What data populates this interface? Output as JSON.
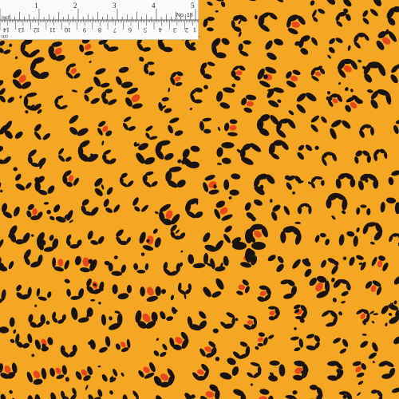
{
  "ruler": {
    "inch_unit": "inch",
    "inch_numbers": [
      "1",
      "2",
      "3",
      "4",
      "5"
    ],
    "cm_numbers": [
      "14",
      "13",
      "12",
      "11",
      "10",
      "9",
      "8",
      "7",
      "6",
      "5",
      "4",
      "3",
      "2",
      "1"
    ],
    "cm_unit": "cm",
    "reference": "No. 18"
  },
  "pattern": {
    "name": "leopard-print",
    "background_color": "#f5a623",
    "spot_color": "#1a1410",
    "accent_color": "#e8471b"
  }
}
